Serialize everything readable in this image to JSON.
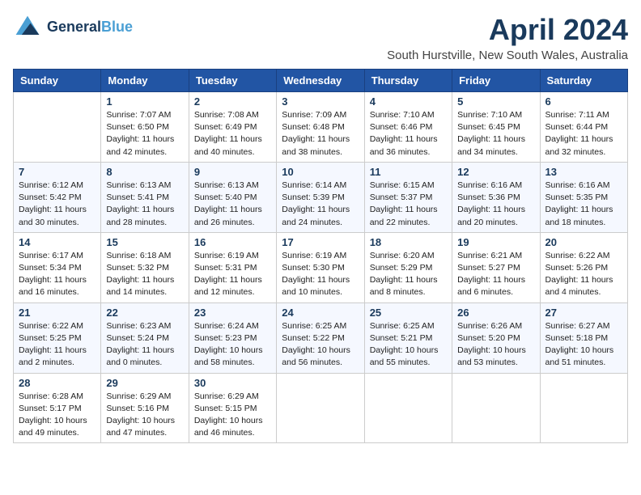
{
  "logo": {
    "line1": "General",
    "line2": "Blue"
  },
  "title": "April 2024",
  "subtitle": "South Hurstville, New South Wales, Australia",
  "weekdays": [
    "Sunday",
    "Monday",
    "Tuesday",
    "Wednesday",
    "Thursday",
    "Friday",
    "Saturday"
  ],
  "weeks": [
    [
      {
        "day": "",
        "info": ""
      },
      {
        "day": "1",
        "info": "Sunrise: 7:07 AM\nSunset: 6:50 PM\nDaylight: 11 hours\nand 42 minutes."
      },
      {
        "day": "2",
        "info": "Sunrise: 7:08 AM\nSunset: 6:49 PM\nDaylight: 11 hours\nand 40 minutes."
      },
      {
        "day": "3",
        "info": "Sunrise: 7:09 AM\nSunset: 6:48 PM\nDaylight: 11 hours\nand 38 minutes."
      },
      {
        "day": "4",
        "info": "Sunrise: 7:10 AM\nSunset: 6:46 PM\nDaylight: 11 hours\nand 36 minutes."
      },
      {
        "day": "5",
        "info": "Sunrise: 7:10 AM\nSunset: 6:45 PM\nDaylight: 11 hours\nand 34 minutes."
      },
      {
        "day": "6",
        "info": "Sunrise: 7:11 AM\nSunset: 6:44 PM\nDaylight: 11 hours\nand 32 minutes."
      }
    ],
    [
      {
        "day": "7",
        "info": "Sunrise: 6:12 AM\nSunset: 5:42 PM\nDaylight: 11 hours\nand 30 minutes."
      },
      {
        "day": "8",
        "info": "Sunrise: 6:13 AM\nSunset: 5:41 PM\nDaylight: 11 hours\nand 28 minutes."
      },
      {
        "day": "9",
        "info": "Sunrise: 6:13 AM\nSunset: 5:40 PM\nDaylight: 11 hours\nand 26 minutes."
      },
      {
        "day": "10",
        "info": "Sunrise: 6:14 AM\nSunset: 5:39 PM\nDaylight: 11 hours\nand 24 minutes."
      },
      {
        "day": "11",
        "info": "Sunrise: 6:15 AM\nSunset: 5:37 PM\nDaylight: 11 hours\nand 22 minutes."
      },
      {
        "day": "12",
        "info": "Sunrise: 6:16 AM\nSunset: 5:36 PM\nDaylight: 11 hours\nand 20 minutes."
      },
      {
        "day": "13",
        "info": "Sunrise: 6:16 AM\nSunset: 5:35 PM\nDaylight: 11 hours\nand 18 minutes."
      }
    ],
    [
      {
        "day": "14",
        "info": "Sunrise: 6:17 AM\nSunset: 5:34 PM\nDaylight: 11 hours\nand 16 minutes."
      },
      {
        "day": "15",
        "info": "Sunrise: 6:18 AM\nSunset: 5:32 PM\nDaylight: 11 hours\nand 14 minutes."
      },
      {
        "day": "16",
        "info": "Sunrise: 6:19 AM\nSunset: 5:31 PM\nDaylight: 11 hours\nand 12 minutes."
      },
      {
        "day": "17",
        "info": "Sunrise: 6:19 AM\nSunset: 5:30 PM\nDaylight: 11 hours\nand 10 minutes."
      },
      {
        "day": "18",
        "info": "Sunrise: 6:20 AM\nSunset: 5:29 PM\nDaylight: 11 hours\nand 8 minutes."
      },
      {
        "day": "19",
        "info": "Sunrise: 6:21 AM\nSunset: 5:27 PM\nDaylight: 11 hours\nand 6 minutes."
      },
      {
        "day": "20",
        "info": "Sunrise: 6:22 AM\nSunset: 5:26 PM\nDaylight: 11 hours\nand 4 minutes."
      }
    ],
    [
      {
        "day": "21",
        "info": "Sunrise: 6:22 AM\nSunset: 5:25 PM\nDaylight: 11 hours\nand 2 minutes."
      },
      {
        "day": "22",
        "info": "Sunrise: 6:23 AM\nSunset: 5:24 PM\nDaylight: 11 hours\nand 0 minutes."
      },
      {
        "day": "23",
        "info": "Sunrise: 6:24 AM\nSunset: 5:23 PM\nDaylight: 10 hours\nand 58 minutes."
      },
      {
        "day": "24",
        "info": "Sunrise: 6:25 AM\nSunset: 5:22 PM\nDaylight: 10 hours\nand 56 minutes."
      },
      {
        "day": "25",
        "info": "Sunrise: 6:25 AM\nSunset: 5:21 PM\nDaylight: 10 hours\nand 55 minutes."
      },
      {
        "day": "26",
        "info": "Sunrise: 6:26 AM\nSunset: 5:20 PM\nDaylight: 10 hours\nand 53 minutes."
      },
      {
        "day": "27",
        "info": "Sunrise: 6:27 AM\nSunset: 5:18 PM\nDaylight: 10 hours\nand 51 minutes."
      }
    ],
    [
      {
        "day": "28",
        "info": "Sunrise: 6:28 AM\nSunset: 5:17 PM\nDaylight: 10 hours\nand 49 minutes."
      },
      {
        "day": "29",
        "info": "Sunrise: 6:29 AM\nSunset: 5:16 PM\nDaylight: 10 hours\nand 47 minutes."
      },
      {
        "day": "30",
        "info": "Sunrise: 6:29 AM\nSunset: 5:15 PM\nDaylight: 10 hours\nand 46 minutes."
      },
      {
        "day": "",
        "info": ""
      },
      {
        "day": "",
        "info": ""
      },
      {
        "day": "",
        "info": ""
      },
      {
        "day": "",
        "info": ""
      }
    ]
  ]
}
